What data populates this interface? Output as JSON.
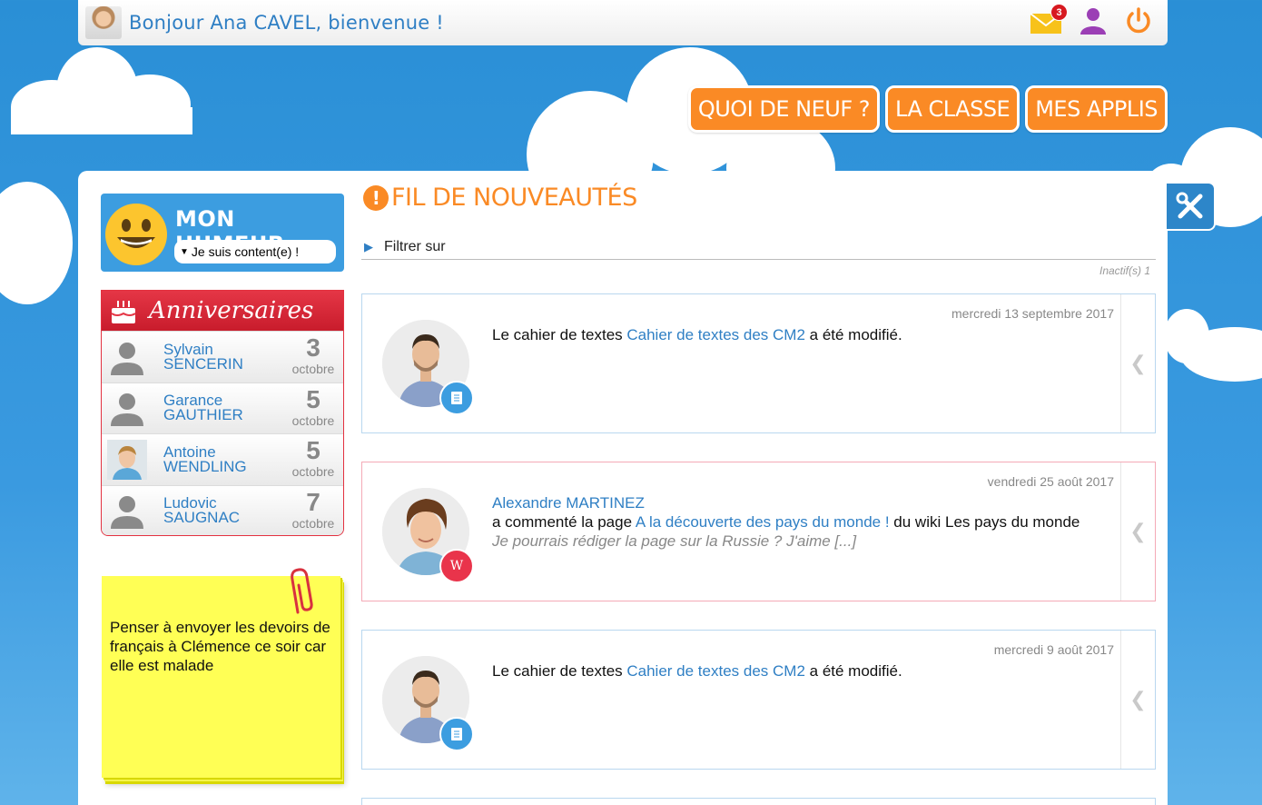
{
  "header": {
    "greeting": "Bonjour Ana CAVEL, bienvenue !",
    "mail_count": "3"
  },
  "nav": {
    "news": "QUOI DE NEUF ?",
    "class": "LA CLASSE",
    "apps": "MES APPLIS"
  },
  "mood": {
    "title": "MON HUMEUR",
    "value": "Je suis content(e) !"
  },
  "birthdays": {
    "title": "Anniversaires",
    "items": [
      {
        "first": "Sylvain",
        "last": "SENCERIN",
        "day": "3",
        "month": "octobre"
      },
      {
        "first": "Garance",
        "last": "GAUTHIER",
        "day": "5",
        "month": "octobre"
      },
      {
        "first": "Antoine",
        "last": "WENDLING",
        "day": "5",
        "month": "octobre"
      },
      {
        "first": "Ludovic",
        "last": "SAUGNAC",
        "day": "7",
        "month": "octobre"
      }
    ]
  },
  "note": {
    "text": "Penser à envoyer les devoirs de français à Clémence ce soir car elle est malade"
  },
  "feed": {
    "title": "FIL DE NOUVEAUTÉS",
    "filter_label": "Filtrer sur",
    "inactive": "Inactif(s) 1",
    "items": [
      {
        "date": "mercredi 13 septembre 2017",
        "pre": "Le cahier de textes ",
        "link": "Cahier de textes des CM2",
        "post": " a été modifié."
      },
      {
        "date": "vendredi 25 août 2017",
        "author": "Alexandre MARTINEZ",
        "pre": "a commenté la page ",
        "link": "A la découverte des pays du monde !",
        "post": " du wiki Les pays du monde",
        "quote": "Je pourrais rédiger la page sur la Russie ? J'aime [...]"
      },
      {
        "date": "mercredi 9 août 2017",
        "pre": "Le cahier de textes ",
        "link": "Cahier de textes des CM2",
        "post": " a été modifié."
      }
    ]
  },
  "colors": {
    "accent_orange": "#fa8a25",
    "link_blue": "#2f7fc4",
    "sky": "#2a8fd6",
    "birthday_red": "#e53646",
    "note_yellow": "#ffff55"
  },
  "icons": {
    "mail": "envelope-icon",
    "profile": "user-icon",
    "logout": "power-icon",
    "tools": "wrench-screwdriver-icon",
    "cake": "cake-icon",
    "doc": "document-icon",
    "wiki": "wiki-icon",
    "expand": "chevron-left-icon"
  }
}
